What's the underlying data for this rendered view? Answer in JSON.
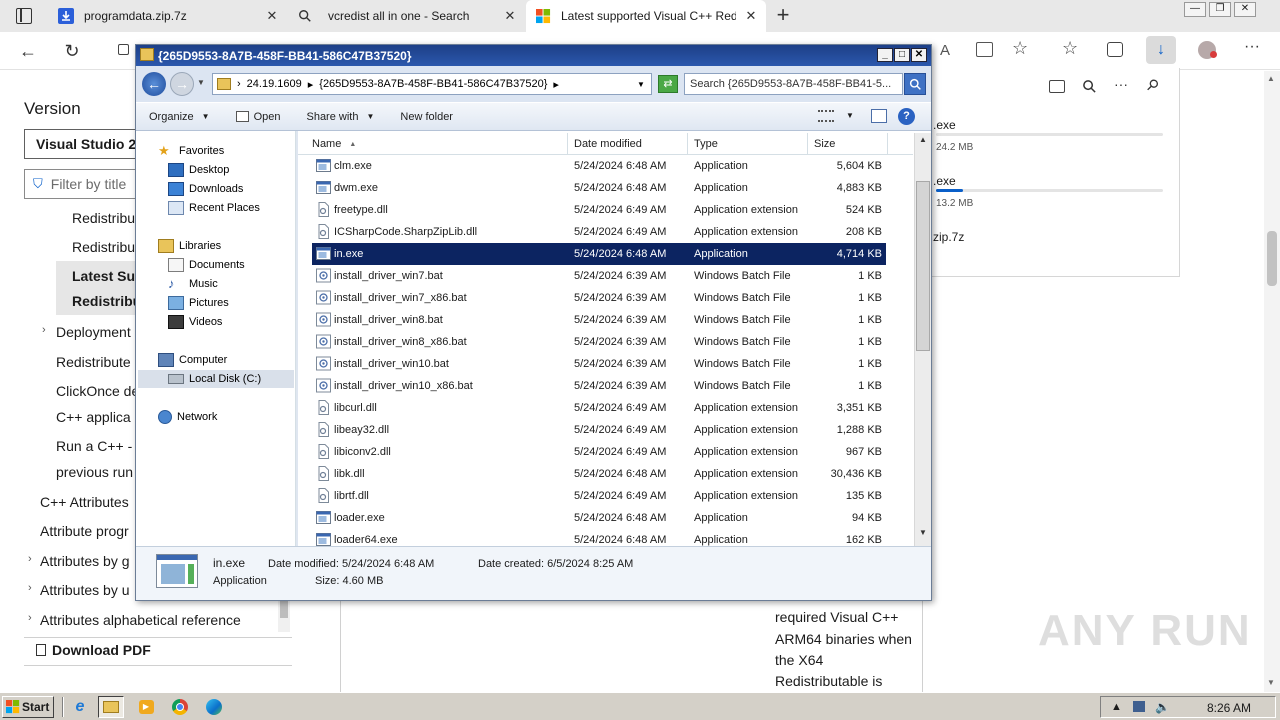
{
  "browser": {
    "tabs": [
      {
        "title": "programdata.zip.7z",
        "icon": "download-icon",
        "accent": "#2b5fd9"
      },
      {
        "title": "vcredist all in one - Search",
        "icon": "search-icon",
        "accent": "#1b1b1b"
      },
      {
        "title": "Latest supported Visual C++ Red",
        "icon": "windows-logo-icon",
        "accent": "#f25022"
      }
    ],
    "new_tab_label": "+",
    "toolbar_icons": [
      "read-aloud-icon",
      "immersive-reader-icon",
      "add-favorite-icon",
      "favorites-icon",
      "collections-icon",
      "downloads-icon",
      "profile-icon",
      "more-icon"
    ]
  },
  "webpage": {
    "version_heading": "Version",
    "version_select": "Visual Studio 20",
    "filter_placeholder": "Filter by title",
    "toc": [
      "Redistribu",
      "Redistribu",
      "Latest Sup",
      "Redistribu",
      "Deployment",
      "Redistribute",
      "ClickOnce de",
      "C++ applica",
      "Run a C++ -",
      "previous run",
      "C++ Attributes",
      "Attribute progr",
      "Attributes by g",
      "Attributes by u",
      "Attributes alphabetical reference"
    ],
    "download_pdf": "Download PDF",
    "body_text": [
      "required Visual C++",
      "ARM64 binaries when",
      "the X64",
      "Redistributable is"
    ]
  },
  "downloads": {
    "items": [
      {
        "name": ".exe",
        "size": "24.2 MB",
        "progress": 0.0
      },
      {
        "name": ".exe",
        "size": "13.2 MB",
        "progress": 0.12
      },
      {
        "name": "zip.7z",
        "size": "",
        "progress": null
      }
    ]
  },
  "explorer": {
    "title": "{265D9553-8A7B-458F-BB41-586C47B37520}",
    "breadcrumb": [
      "24.19.1609",
      "{265D9553-8A7B-458F-BB41-586C47B37520}"
    ],
    "search_placeholder": "Search {265D9553-8A7B-458F-BB41-5...",
    "toolbar": {
      "organize": "Organize",
      "open": "Open",
      "share_with": "Share with",
      "new_folder": "New folder"
    },
    "nav": {
      "favorites": "Favorites",
      "desktop": "Desktop",
      "downloads": "Downloads",
      "recent_places": "Recent Places",
      "libraries": "Libraries",
      "documents": "Documents",
      "music": "Music",
      "pictures": "Pictures",
      "videos": "Videos",
      "computer": "Computer",
      "local_disk": "Local Disk (C:)",
      "network": "Network"
    },
    "columns": {
      "name": "Name",
      "date_modified": "Date modified",
      "type": "Type",
      "size": "Size"
    },
    "files": [
      {
        "name": "clm.exe",
        "date": "5/24/2024 6:48 AM",
        "type": "Application",
        "size": "5,604 KB",
        "icon": "exe"
      },
      {
        "name": "dwm.exe",
        "date": "5/24/2024 6:48 AM",
        "type": "Application",
        "size": "4,883 KB",
        "icon": "exe"
      },
      {
        "name": "freetype.dll",
        "date": "5/24/2024 6:49 AM",
        "type": "Application extension",
        "size": "524 KB",
        "icon": "dll"
      },
      {
        "name": "ICSharpCode.SharpZipLib.dll",
        "date": "5/24/2024 6:49 AM",
        "type": "Application extension",
        "size": "208 KB",
        "icon": "dll"
      },
      {
        "name": "in.exe",
        "date": "5/24/2024 6:48 AM",
        "type": "Application",
        "size": "4,714 KB",
        "icon": "exe"
      },
      {
        "name": "install_driver_win7.bat",
        "date": "5/24/2024 6:39 AM",
        "type": "Windows Batch File",
        "size": "1 KB",
        "icon": "bat"
      },
      {
        "name": "install_driver_win7_x86.bat",
        "date": "5/24/2024 6:39 AM",
        "type": "Windows Batch File",
        "size": "1 KB",
        "icon": "bat"
      },
      {
        "name": "install_driver_win8.bat",
        "date": "5/24/2024 6:39 AM",
        "type": "Windows Batch File",
        "size": "1 KB",
        "icon": "bat"
      },
      {
        "name": "install_driver_win8_x86.bat",
        "date": "5/24/2024 6:39 AM",
        "type": "Windows Batch File",
        "size": "1 KB",
        "icon": "bat"
      },
      {
        "name": "install_driver_win10.bat",
        "date": "5/24/2024 6:39 AM",
        "type": "Windows Batch File",
        "size": "1 KB",
        "icon": "bat"
      },
      {
        "name": "install_driver_win10_x86.bat",
        "date": "5/24/2024 6:39 AM",
        "type": "Windows Batch File",
        "size": "1 KB",
        "icon": "bat"
      },
      {
        "name": "libcurl.dll",
        "date": "5/24/2024 6:49 AM",
        "type": "Application extension",
        "size": "3,351 KB",
        "icon": "dll"
      },
      {
        "name": "libeay32.dll",
        "date": "5/24/2024 6:49 AM",
        "type": "Application extension",
        "size": "1,288 KB",
        "icon": "dll"
      },
      {
        "name": "libiconv2.dll",
        "date": "5/24/2024 6:49 AM",
        "type": "Application extension",
        "size": "967 KB",
        "icon": "dll"
      },
      {
        "name": "libk.dll",
        "date": "5/24/2024 6:48 AM",
        "type": "Application extension",
        "size": "30,436 KB",
        "icon": "dll"
      },
      {
        "name": "librtf.dll",
        "date": "5/24/2024 6:49 AM",
        "type": "Application extension",
        "size": "135 KB",
        "icon": "dll"
      },
      {
        "name": "loader.exe",
        "date": "5/24/2024 6:48 AM",
        "type": "Application",
        "size": "94 KB",
        "icon": "exe"
      },
      {
        "name": "loader64.exe",
        "date": "5/24/2024 6:48 AM",
        "type": "Application",
        "size": "162 KB",
        "icon": "exe"
      }
    ],
    "selected_index": 4,
    "details": {
      "name": "in.exe",
      "type": "Application",
      "date_modified": "Date modified: 5/24/2024 6:48 AM",
      "date_created": "Date created: 6/5/2024 8:25 AM",
      "size": "Size: 4.60 MB"
    }
  },
  "taskbar": {
    "start_label": "Start",
    "clock": "8:26 AM",
    "apps": [
      "ie-icon",
      "explorer-folder-icon",
      "media-player-icon",
      "chrome-icon",
      "edge-icon"
    ]
  },
  "watermark": "ANY RUN",
  "colors": {
    "selection": "#0c2461",
    "titlebar": "#1d3f87",
    "taskbar": "#d4d0c8"
  }
}
